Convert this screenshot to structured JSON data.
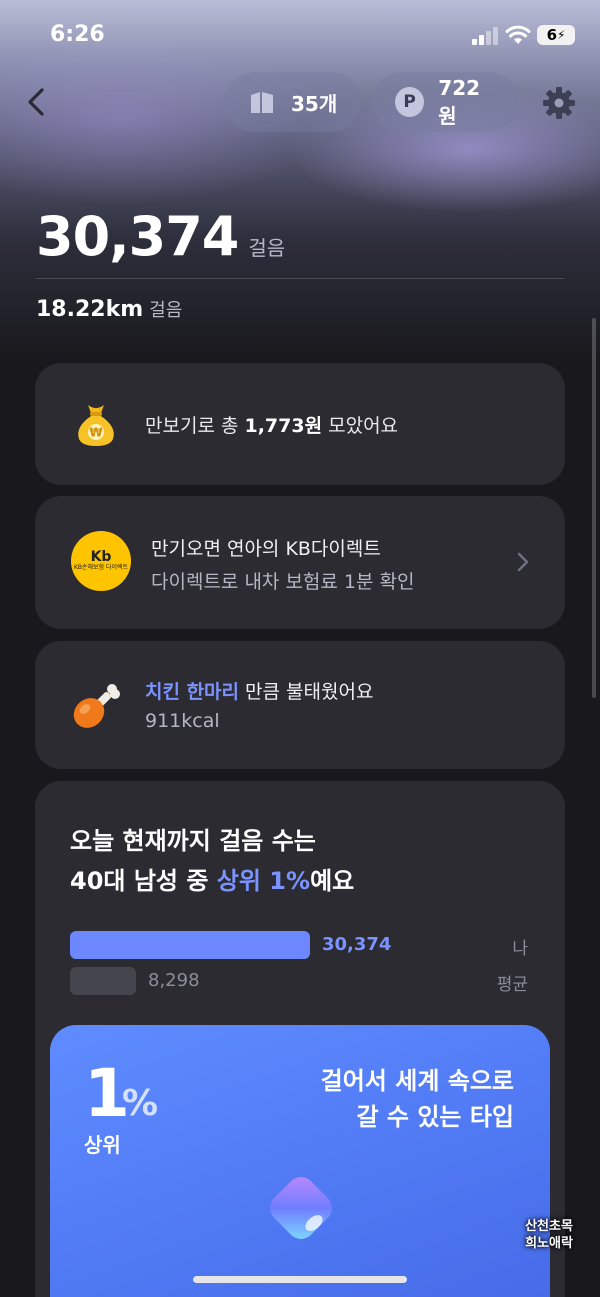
{
  "status_bar": {
    "time": "6:26",
    "battery": "6"
  },
  "header": {
    "tickets_label": "35개",
    "points_symbol": "P",
    "points_label": "722원"
  },
  "summary": {
    "steps": "30,374",
    "steps_unit": "걸음",
    "distance": "18.22km",
    "distance_unit": "걸음"
  },
  "savings_card": {
    "prefix": "만보기로 총 ",
    "amount": "1,773원",
    "suffix": " 모았어요"
  },
  "ad_card": {
    "logo_mark": "Kb",
    "logo_text": "KB손해보험 다이렉트",
    "title": "만기오면 연아의 KB다이렉트",
    "subtitle": "다이렉트로 내차 보험료 1분 확인"
  },
  "calorie_card": {
    "highlight": "치킨 한마리",
    "suffix": " 만큼 불태웠어요",
    "kcal": "911kcal"
  },
  "ranking_card": {
    "line1": "오늘 현재까지 걸음 수는",
    "line2_prefix": "40대 남성 중 ",
    "line2_highlight": "상위 1%",
    "line2_suffix": "예요",
    "me_value": 30374,
    "me_value_label": "30,374",
    "me_label": "나",
    "avg_value": 8298,
    "avg_value_label": "8,298",
    "avg_label": "평균"
  },
  "type_card": {
    "percent": "1",
    "percent_sign": "%",
    "rank_label": "상위",
    "desc_line1": "걸어서 세계 속으로",
    "desc_line2": "갈 수 있는 타입"
  },
  "watermark": {
    "line1": "산천초목",
    "line2": "희노애락"
  },
  "colors": {
    "accent": "#7b93ff",
    "card": "#2b2b31",
    "background": "#19191d",
    "type_card": "#5a85fc"
  },
  "icons": [
    "back-icon",
    "ticket-icon",
    "points-icon",
    "gear-icon",
    "money-bag-icon",
    "chevron-right-icon",
    "chicken-leg-icon",
    "gem-icon"
  ]
}
